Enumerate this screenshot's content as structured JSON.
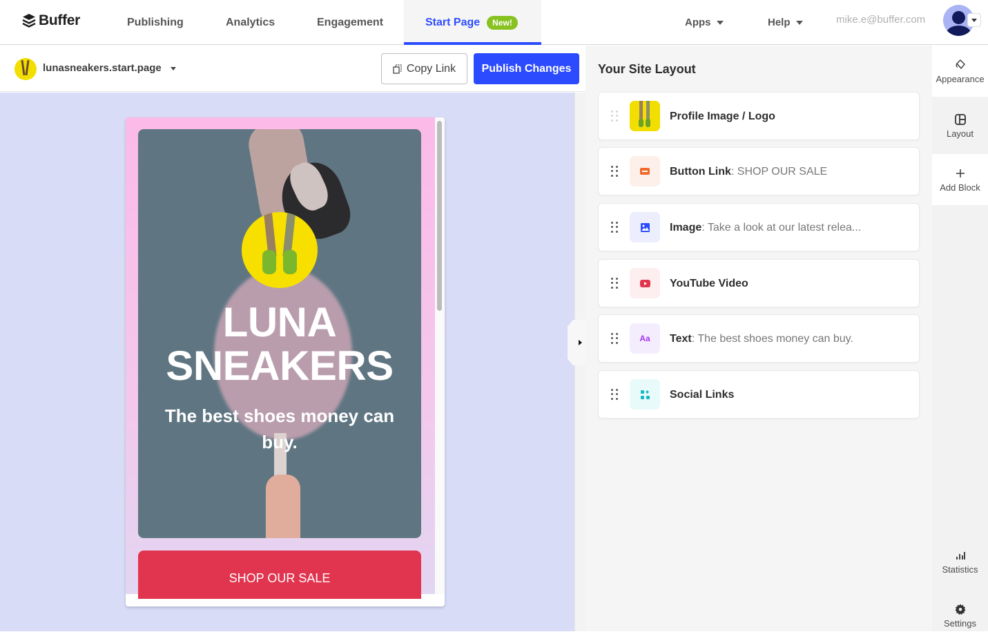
{
  "topnav": {
    "brand": "Buffer",
    "items": [
      {
        "label": "Publishing",
        "active": false
      },
      {
        "label": "Analytics",
        "active": false
      },
      {
        "label": "Engagement",
        "active": false
      },
      {
        "label": "Start Page",
        "active": true,
        "badge": "New!"
      }
    ],
    "apps_label": "Apps",
    "help_label": "Help",
    "user_email": "mike.e@buffer.com",
    "accent_color": "#2c4bff",
    "badge_color": "#87c221"
  },
  "editor": {
    "site_name": "lunasneakers.start.page",
    "copy_link_label": "Copy Link",
    "publish_label": "Publish Changes"
  },
  "preview": {
    "title": "LUNA SNEAKERS",
    "title_line1": "LUNA",
    "title_line2": "SNEAKERS",
    "subtitle": "The best shoes money can buy.",
    "button_label": "SHOP OUR SALE",
    "button_color": "#e1354f",
    "background_color": "#d8dcf7"
  },
  "layout_panel": {
    "title": "Your Site Layout",
    "blocks": [
      {
        "type": "Profile Image / Logo",
        "desc": "",
        "icon": "profile-image-icon"
      },
      {
        "type": "Button Link",
        "desc": "SHOP OUR SALE",
        "icon": "button-link-icon"
      },
      {
        "type": "Image",
        "desc": "Take a look at our latest relea...",
        "icon": "image-icon"
      },
      {
        "type": "YouTube Video",
        "desc": "",
        "icon": "youtube-icon"
      },
      {
        "type": "Text",
        "desc": "The best shoes money can buy.",
        "icon": "text-icon",
        "icon_text": "Aa"
      },
      {
        "type": "Social Links",
        "desc": "",
        "icon": "social-links-icon"
      }
    ]
  },
  "right_rail": {
    "items": [
      {
        "label": "Appearance",
        "icon": "paint-bucket-icon"
      },
      {
        "label": "Layout",
        "icon": "layout-icon"
      },
      {
        "label": "Add Block",
        "icon": "plus-icon"
      },
      {
        "label": "Statistics",
        "icon": "bar-chart-icon"
      },
      {
        "label": "Settings",
        "icon": "gear-icon"
      }
    ]
  }
}
